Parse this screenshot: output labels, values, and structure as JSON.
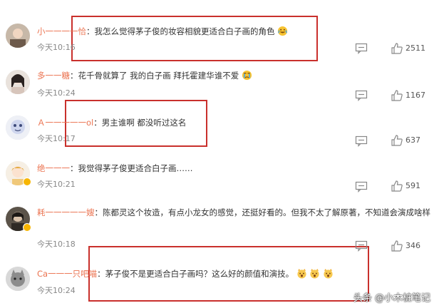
{
  "comments": [
    {
      "username": "小一一一一恰",
      "text": "我怎么觉得茅子俊的妆容相貌更适合白子画的角色",
      "time": "今天10:16",
      "likes": "2511",
      "emoji": [
        "cry-laugh"
      ]
    },
    {
      "username": "多一一糖",
      "text": "花千骨就算了 我的白子画 拜托霍建华谁不爱",
      "time": "今天10:24",
      "likes": "1167",
      "emoji": [
        "cry"
      ]
    },
    {
      "username": "Ａ一一一一一ol",
      "text": "男主谁啊 都没听过这名",
      "time": "今天10:17",
      "likes": "637"
    },
    {
      "username": "绝一一一",
      "text": "我觉得茅子俊更适合白子画……",
      "time": "今天10:21",
      "likes": "591"
    },
    {
      "username": "耗一一一一一嫂",
      "text": "陈都灵这个妆造，有点小龙女的感觉，还挺好看的。但我不太了解原著，不知道会演成啥样",
      "time": "今天10:18",
      "likes": "346"
    },
    {
      "username": "Ca一一一只吧喵",
      "text": "茅子俊不是更适合白子画吗？这么好的颜值和演技。",
      "time": "今天10:24",
      "likes": "",
      "emoji": [
        "surprised-cat",
        "surprised-cat",
        "surprised-cat"
      ]
    }
  ],
  "colon": "：",
  "watermark": "头条 @小木桩笔记",
  "colors": {
    "username": "#eb7350",
    "highlight_box": "#c9302c",
    "verified": "#f7b500"
  }
}
